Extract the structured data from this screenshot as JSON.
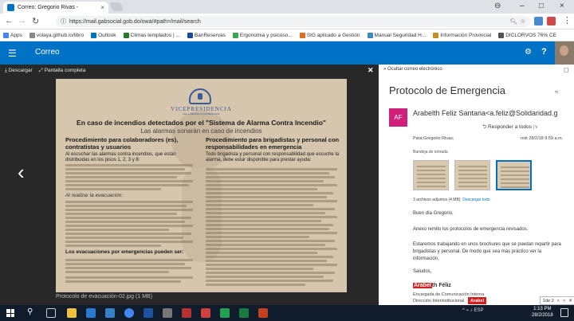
{
  "browser": {
    "tab_title": "Correo: Gregorio Rivas - ",
    "url": "https://mail.gabsocial.gob.do/owa/#path=/mail/search",
    "window_controls": {
      "minimize": "–",
      "maximize": "□",
      "close": "×",
      "account": "⊖"
    },
    "bookmarks": [
      {
        "label": "Apps",
        "color": "#4285f4"
      },
      {
        "label": "volaya.github.io/libro",
        "color": "#888888"
      },
      {
        "label": "Outlook",
        "color": "#0072c6"
      },
      {
        "label": "Climas templados | ...",
        "color": "#2a7a2a"
      },
      {
        "label": "BanReservas",
        "color": "#1a4a9a"
      },
      {
        "label": "Ergonomia y psicoso...",
        "color": "#34a853"
      },
      {
        "label": "SIG aplicado a Gestión",
        "color": "#e07020"
      },
      {
        "label": "Manual Seguridad H...",
        "color": "#3a8ac0"
      },
      {
        "label": "Información Provincial",
        "color": "#c09020"
      },
      {
        "label": "DICLORVOS 76% CE",
        "color": "#555555"
      }
    ]
  },
  "app": {
    "title": "Correo"
  },
  "viewer": {
    "download_label": "Descargar",
    "fullscreen_label": "Pantalla completa",
    "filename": "Protocolo de evacuación-02.jpg",
    "filesize": "(1 MB)",
    "document": {
      "institution": "VICEPRESIDENCIA",
      "institution_sub": "DE LA REPÚBLICA DOMINICANA",
      "title": "En caso de incendios detectados por el \"Sistema de Alarma Contra Incendio\"",
      "subtitle": "Las alarmas sonarán en caso de incendios",
      "left_heading": "Procedimiento para colaboradores (es), contratistas y usuarios",
      "left_intro": "Al escuchar las alarmas contra incendios, que están distribuidas en los pisos 1, 2, 3 y 8:",
      "left_section2": "Al realizar la evacuación:",
      "left_section3": "Los evacuaciones por emergencias pueden ser:",
      "right_heading": "Procedimiento para brigadistas y personal con responsabilidades en emergencia",
      "right_intro": "Todo brigadista y personal con responsabilidad que escuche la alarma, debe estar disponible para prestar ayuda:"
    }
  },
  "reading_pane": {
    "hide_label": "Ocultar correo electrónico",
    "subject": "Protocolo de Emergencia",
    "sender_initials": "AF",
    "sender": "Arabelth Feliz Santana<a.feliz@Solidaridad.g",
    "reply_all_label": "Responder a todos",
    "to_line": "Para:Gregorio Rivas;",
    "datetime": "mié 28/2/18 9:59 a.m.",
    "folder": "Bandeja de entrada",
    "attachments_info": "3 archivos adjuntos (4 MB)",
    "download_all_label": "Descargar todo",
    "greeting": "Buen día Gregorio,",
    "para1": "Anexo remito los protocolos de emergencia revisados.",
    "para2": "Estaremos trabajando en unos brochures que se puedan repartir para brigadistas y personal. De modo que sea más práctico ver la información.",
    "closing": "Saludos,",
    "sig_highlight": "Arabel",
    "sig_rest": "th Féliz",
    "sig_title": "Encargada de Comunicación Interna",
    "sig_dept": "Dirección Interinstitucional",
    "find_term": "Arabel",
    "find_count": "1de 2"
  },
  "taskbar": {
    "tray_text": "ESP",
    "time": "1:13 PM",
    "date": "28/2/2018"
  },
  "colors": {
    "accent": "#0072c6",
    "sender_badge": "#d1207c",
    "highlight": "#d42020"
  }
}
